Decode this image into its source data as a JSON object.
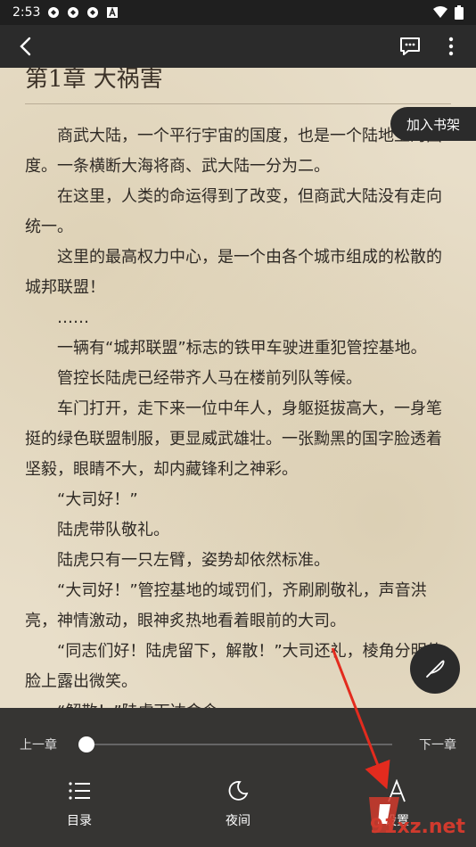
{
  "status_bar": {
    "time": "2:53"
  },
  "chapter": {
    "title": "第1章 大祸害"
  },
  "bookshelf_button": "加入书架",
  "paragraphs": [
    "商武大陆，一个平行宇宙的国度，也是一个陆地上的国度。一条横断大海将商、武大陆一分为二。",
    "在这里，人类的命运得到了改变，但商武大陆没有走向统一。",
    "这里的最高权力中心，是一个由各个城市组成的松散的城邦联盟！",
    "……",
    "一辆有“城邦联盟”标志的铁甲车驶进重犯管控基地。",
    "管控长陆虎已经带齐人马在楼前列队等候。",
    "车门打开，走下来一位中年人，身躯挺拔高大，一身笔挺的绿色联盟制服，更显威武雄壮。一张黝黑的国字脸透着坚毅，眼睛不大，却内藏锋利之神彩。",
    "“大司好！”",
    "陆虎带队敬礼。",
    "陆虎只有一只左臂，姿势却依然标准。",
    "“大司好！”管控基地的域罚们，齐刷刷敬礼，声音洪亮，神情激动，眼神炙热地看着眼前的大司。",
    "“同志们好！陆虎留下，解散！”大司还礼，棱角分明的脸上露出微笑。",
    "“解散！”陆虎下达命令。"
  ],
  "progress": {
    "prev_label": "上一章",
    "next_label": "下一章",
    "value": 0
  },
  "nav": {
    "catalog_label": "目录",
    "night_label": "夜间",
    "settings_label": "设置"
  },
  "watermark": {
    "text": "91xz.net"
  },
  "colors": {
    "accent": "#d03a2d",
    "panel": "#2b2b2b",
    "paper": "#e8dec9"
  }
}
